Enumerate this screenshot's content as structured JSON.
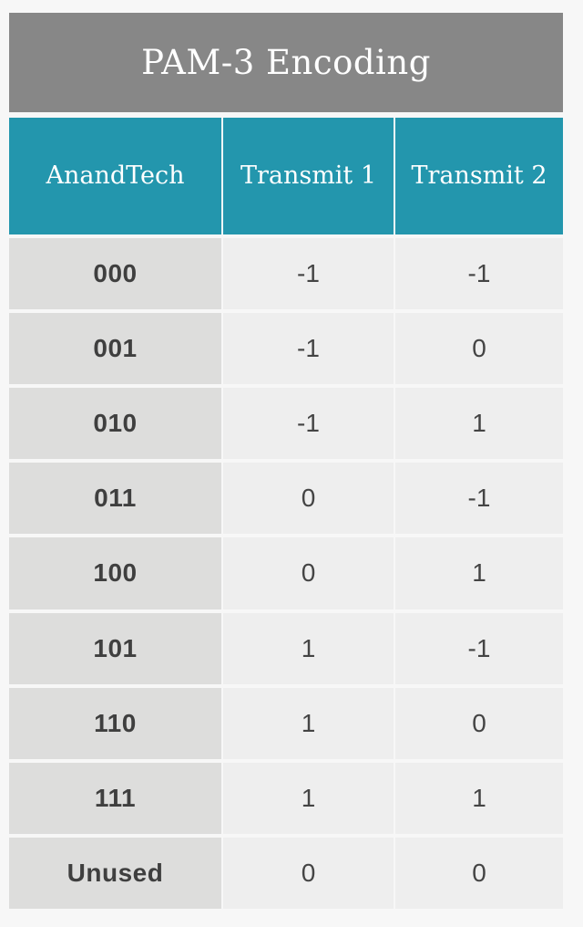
{
  "table": {
    "title": "PAM-3 Encoding",
    "columns": [
      "AnandTech",
      "Transmit 1",
      "Transmit 2"
    ],
    "rows": [
      {
        "code": "000",
        "t1": "-1",
        "t2": "-1"
      },
      {
        "code": "001",
        "t1": "-1",
        "t2": "0"
      },
      {
        "code": "010",
        "t1": "-1",
        "t2": "1"
      },
      {
        "code": "011",
        "t1": "0",
        "t2": "-1"
      },
      {
        "code": "100",
        "t1": "0",
        "t2": "1"
      },
      {
        "code": "101",
        "t1": "1",
        "t2": "-1"
      },
      {
        "code": "110",
        "t1": "1",
        "t2": "0"
      },
      {
        "code": "111",
        "t1": "1",
        "t2": "1"
      },
      {
        "code": "Unused",
        "t1": "0",
        "t2": "0"
      }
    ]
  },
  "colors": {
    "title_bar": "#878787",
    "header": "#2396ad",
    "key_cell": "#dddddc",
    "value_cell": "#eeeeee",
    "page_background": "#f7f7f7"
  }
}
